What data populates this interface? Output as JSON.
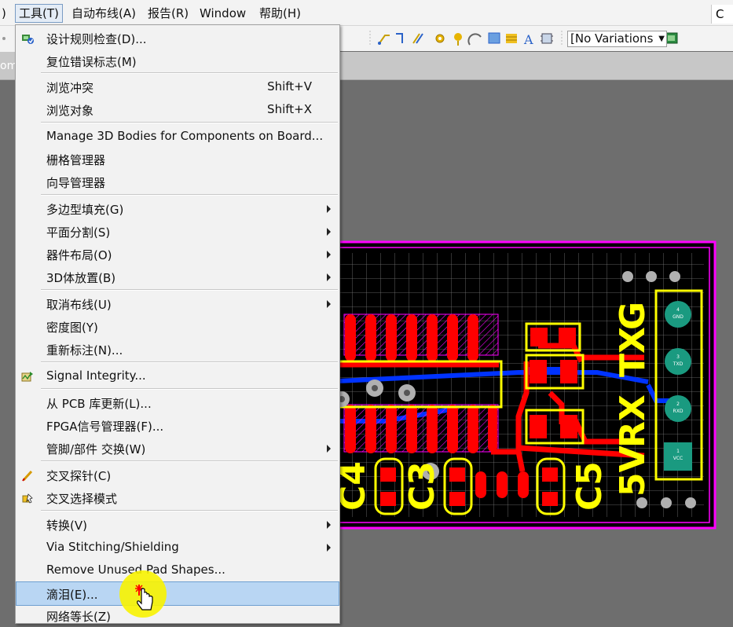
{
  "menubar": {
    "items": [
      {
        "label": ")"
      },
      {
        "label": "工具(T)"
      },
      {
        "label": "自动布线(A)"
      },
      {
        "label": "报告(R)"
      },
      {
        "label": "Window"
      },
      {
        "label": "帮助(H)"
      }
    ],
    "right_fragment": "C"
  },
  "tab_fragment": "om",
  "toolbar": {
    "variant_select": "[No Variations"
  },
  "menu": {
    "items": [
      {
        "label": "设计规则检查(D)...",
        "shortcut": "",
        "submenu": false,
        "icon": "drc-icon"
      },
      {
        "label": "复位错误标志(M)",
        "shortcut": "",
        "submenu": false,
        "icon": ""
      },
      {
        "label": "浏览冲突",
        "shortcut": "Shift+V",
        "submenu": false,
        "icon": ""
      },
      {
        "label": "浏览对象",
        "shortcut": "Shift+X",
        "submenu": false,
        "icon": ""
      },
      {
        "label": "Manage 3D Bodies for Components on Board...",
        "shortcut": "",
        "submenu": false,
        "icon": ""
      },
      {
        "label": "栅格管理器",
        "shortcut": "",
        "submenu": false,
        "icon": ""
      },
      {
        "label": "向导管理器",
        "shortcut": "",
        "submenu": false,
        "icon": ""
      },
      {
        "label": "多边型填充(G)",
        "shortcut": "",
        "submenu": true,
        "icon": ""
      },
      {
        "label": "平面分割(S)",
        "shortcut": "",
        "submenu": true,
        "icon": ""
      },
      {
        "label": "器件布局(O)",
        "shortcut": "",
        "submenu": true,
        "icon": ""
      },
      {
        "label": "3D体放置(B)",
        "shortcut": "",
        "submenu": true,
        "icon": ""
      },
      {
        "label": "取消布线(U)",
        "shortcut": "",
        "submenu": true,
        "icon": ""
      },
      {
        "label": "密度图(Y)",
        "shortcut": "",
        "submenu": false,
        "icon": ""
      },
      {
        "label": "重新标注(N)...",
        "shortcut": "",
        "submenu": false,
        "icon": ""
      },
      {
        "label": "Signal Integrity...",
        "shortcut": "",
        "submenu": false,
        "icon": "signal-integrity-icon"
      },
      {
        "label": "从 PCB 库更新(L)...",
        "shortcut": "",
        "submenu": false,
        "icon": ""
      },
      {
        "label": "FPGA信号管理器(F)...",
        "shortcut": "",
        "submenu": false,
        "icon": ""
      },
      {
        "label": "管脚/部件 交换(W)",
        "shortcut": "",
        "submenu": true,
        "icon": ""
      },
      {
        "label": "交叉探针(C)",
        "shortcut": "",
        "submenu": false,
        "icon": "cross-probe-icon"
      },
      {
        "label": "交叉选择模式",
        "shortcut": "",
        "submenu": false,
        "icon": "cross-select-icon"
      },
      {
        "label": "转换(V)",
        "shortcut": "",
        "submenu": true,
        "icon": ""
      },
      {
        "label": "Via Stitching/Shielding",
        "shortcut": "",
        "submenu": true,
        "icon": ""
      },
      {
        "label": "Remove Unused Pad Shapes...",
        "shortcut": "",
        "submenu": false,
        "icon": ""
      },
      {
        "label": "滴泪(E)...",
        "shortcut": "",
        "submenu": false,
        "icon": "",
        "highlighted": true
      },
      {
        "label": "网络等长(Z)",
        "shortcut": "",
        "submenu": false,
        "icon": ""
      }
    ]
  },
  "pcb": {
    "labels": {
      "c4": "C4",
      "c3": "C3",
      "c5": "C5",
      "v5": "5V",
      "rx": "RX",
      "tx": "TX",
      "g": "G"
    },
    "pads": [
      "GND",
      "TXD",
      "RXD",
      "VCC"
    ],
    "pad_numbers": [
      "4",
      "3",
      "2",
      "1"
    ]
  },
  "colors": {
    "board_outline": "#ff00ff",
    "silkscreen": "#ffff00",
    "top_copper": "#ff0000",
    "bottom_copper": "#0033ff",
    "board_bg": "#000000",
    "highlight": "#b9d6f3"
  }
}
